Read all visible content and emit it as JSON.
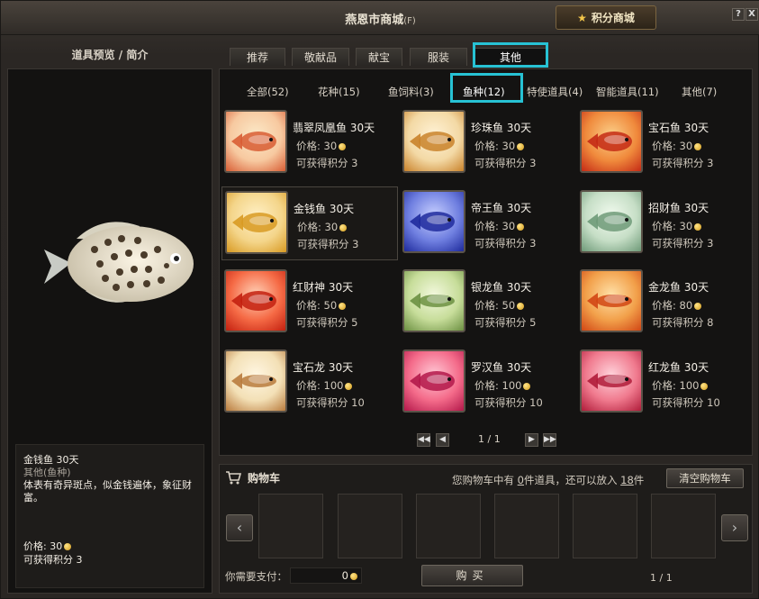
{
  "window": {
    "title": "燕恩市商城",
    "title_suffix": "(F)",
    "points_button": "积分商城",
    "help": "?",
    "close": "X"
  },
  "left": {
    "header": "道具预览  /  简介",
    "selected": {
      "name": "金钱鱼   30天",
      "category": "其他(鱼种)",
      "description": "体表有奇异斑点，似金钱遍体，象征财富。",
      "price": "价格: 30",
      "points": "可获得积分   3"
    }
  },
  "tabs": [
    {
      "label": "推荐"
    },
    {
      "label": "敬献品"
    },
    {
      "label": "献宝"
    },
    {
      "label": "服装"
    },
    {
      "label": "其他"
    }
  ],
  "subtabs": [
    {
      "label": "全部(52)"
    },
    {
      "label": "花种(15)"
    },
    {
      "label": "鱼饲料(3)"
    },
    {
      "label": "鱼种(12)"
    },
    {
      "label": "特使道具(4)"
    },
    {
      "label": "智能道具(11)"
    },
    {
      "label": "其他(7)"
    }
  ],
  "items": [
    {
      "name": "翡翠凤凰鱼  30天",
      "price": "价格:  30",
      "points": "可获得积分   3"
    },
    {
      "name": "珍珠鱼  30天",
      "price": "价格:  30",
      "points": "可获得积分   3"
    },
    {
      "name": "宝石鱼  30天",
      "price": "价格:  30",
      "points": "可获得积分   3"
    },
    {
      "name": "金钱鱼   30天",
      "price": "价格:  30",
      "points": "可获得积分   3"
    },
    {
      "name": "帝王鱼  30天",
      "price": "价格:  30",
      "points": "可获得积分   3"
    },
    {
      "name": "招财鱼   30天",
      "price": "价格:  30",
      "points": "可获得积分   3"
    },
    {
      "name": "红财神  30天",
      "price": "价格:  50",
      "points": "可获得积分   5"
    },
    {
      "name": "银龙鱼  30天",
      "price": "价格:  50",
      "points": "可获得积分   5"
    },
    {
      "name": "金龙鱼  30天",
      "price": "价格:  80",
      "points": "可获得积分   8"
    },
    {
      "name": "宝石龙   30天",
      "price": "价格:  100",
      "points": "可获得积分   10"
    },
    {
      "name": "罗汉鱼  30天",
      "price": "价格:  100",
      "points": "可获得积分   10"
    },
    {
      "name": "红龙鱼  30天",
      "price": "价格:  100",
      "points": "可获得积分   10"
    }
  ],
  "item_colors": [
    [
      "#f7c9a0",
      "#d85d34",
      "#fbe9c8"
    ],
    [
      "#f3d9a5",
      "#c9822a",
      "#fff2d6"
    ],
    [
      "#f08a3c",
      "#c42a15",
      "#fbd08a"
    ],
    [
      "#f4d58a",
      "#d89a22",
      "#fff0c6"
    ],
    [
      "#6f7fe0",
      "#1e2a9c",
      "#c8d0ff"
    ],
    [
      "#c6dec6",
      "#6e9a78",
      "#f2fbef"
    ],
    [
      "#f56a45",
      "#c3200f",
      "#ffd2b8"
    ],
    [
      "#c7dd9a",
      "#6c9042",
      "#f2f8dd"
    ],
    [
      "#f2a04a",
      "#d14614",
      "#ffe1a8"
    ],
    [
      "#f3e0b6",
      "#b97b3d",
      "#fff6e2"
    ],
    [
      "#f46b8a",
      "#b3184a",
      "#ffc9d6"
    ],
    [
      "#f07a8e",
      "#b01c3a",
      "#ffd3db"
    ]
  ],
  "pager": {
    "text": "1 / 1"
  },
  "cart": {
    "title": "购物车",
    "info_prefix": "您购物车中有 ",
    "count": "0",
    "info_mid": "件道具，还可以放入 ",
    "capacity": "18",
    "info_suffix": "件",
    "clear": "清空购物车",
    "pay_label": "你需要支付：",
    "pay_value": "0",
    "buy": "购买",
    "page": "1 / 1"
  }
}
